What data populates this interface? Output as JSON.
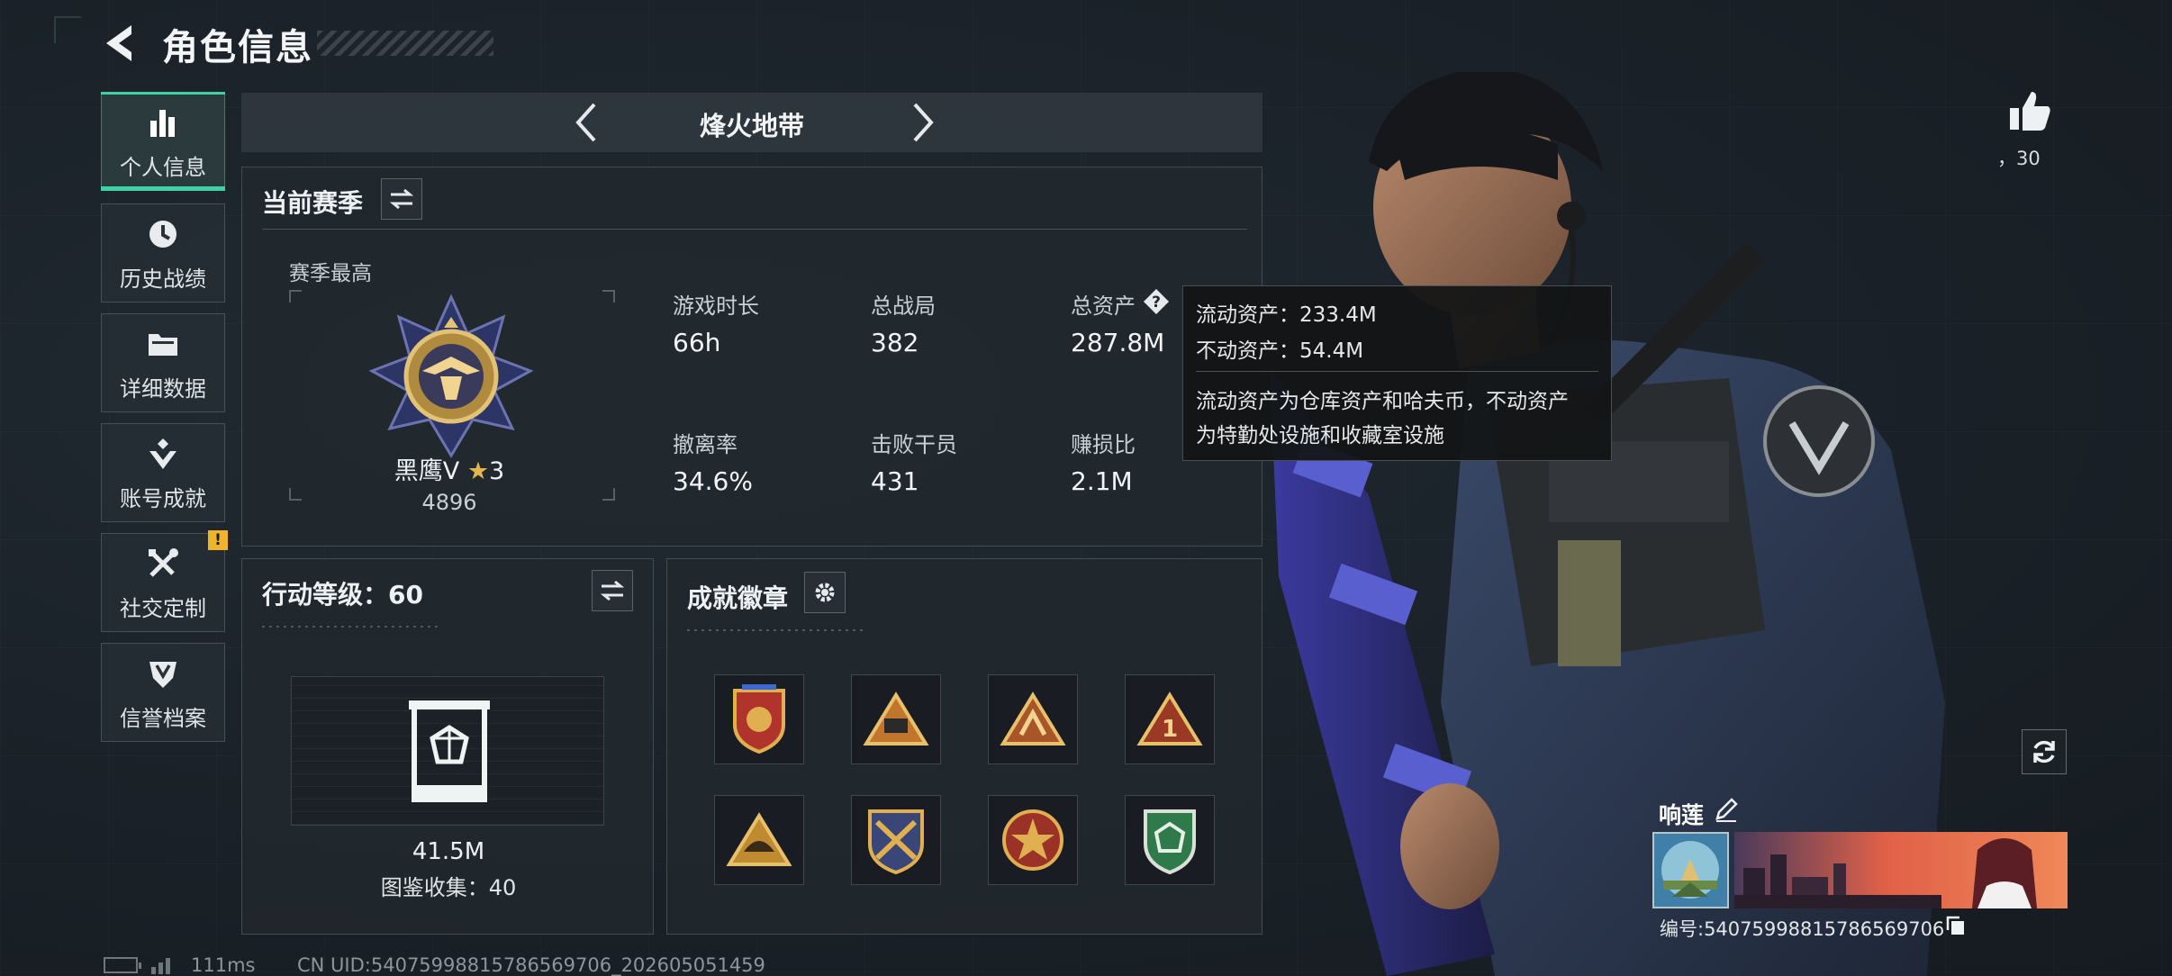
{
  "header": {
    "title": "角色信息"
  },
  "nav": {
    "items": [
      {
        "label": "个人信息",
        "icon": "bar-chart-icon",
        "active": true
      },
      {
        "label": "历史战绩",
        "icon": "history-clock-icon"
      },
      {
        "label": "详细数据",
        "icon": "folder-icon"
      },
      {
        "label": "账号成就",
        "icon": "achievement-icon"
      },
      {
        "label": "社交定制",
        "icon": "tools-icon",
        "badge": "!"
      },
      {
        "label": "信誉档案",
        "icon": "reputation-shield-icon"
      }
    ]
  },
  "mode": {
    "title": "烽火地带"
  },
  "season": {
    "title": "当前赛季",
    "best_label": "赛季最高",
    "rank_name": "黑鹰V",
    "rank_stars": "3",
    "rank_points": "4896",
    "stats": [
      {
        "label": "游戏时长",
        "value": "66h"
      },
      {
        "label": "总战局",
        "value": "382"
      },
      {
        "label": "总资产",
        "value": "287.8M"
      },
      {
        "label": "撤离率",
        "value": "34.6%"
      },
      {
        "label": "击败干员",
        "value": "431"
      },
      {
        "label": "赚损比",
        "value": "2.1M"
      }
    ]
  },
  "tooltip": {
    "liquid": "流动资产：233.4M",
    "fixed": "不动资产：54.4M",
    "desc1": "流动资产为仓库资产和哈夫币，不动资产",
    "desc2": "为特勤处设施和收藏室设施"
  },
  "action": {
    "title": "行动等级：60",
    "value": "41.5M",
    "collection": "图鉴收集：40"
  },
  "achievements": {
    "title": "成就徽章",
    "badge_count": 8
  },
  "profile": {
    "likes": "，30",
    "name": "响莲",
    "id": "编号:5407599881578656970​6"
  },
  "status": {
    "ping": "111ms",
    "uid": "CN UID:5407599881578656970​6_20260505145​9"
  },
  "colors": {
    "accent": "#3fd0a4",
    "badge": "#f0b429",
    "panel": "#21282e"
  }
}
